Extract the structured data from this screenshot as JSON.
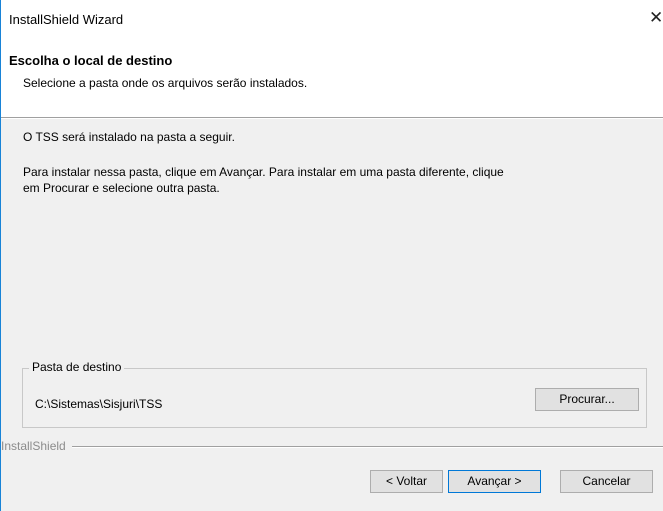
{
  "window": {
    "title": "InstallShield Wizard",
    "close_glyph": "✕"
  },
  "header": {
    "title": "Escolha o local de destino",
    "subtitle": "Selecione a pasta onde os arquivos serão instalados."
  },
  "body": {
    "line1": "O TSS será instalado na pasta a seguir.",
    "line2a": "Para instalar nessa pasta, clique em Avançar. Para instalar em uma pasta diferente, clique",
    "line2b": "em Procurar e selecione outra pasta."
  },
  "destination": {
    "legend": "Pasta de destino",
    "path": "C:\\Sistemas\\Sisjuri\\TSS",
    "browse_label": "Procurar..."
  },
  "footer": {
    "brand": "InstallShield",
    "back_label": "< Voltar",
    "next_label": "Avançar >",
    "cancel_label": "Cancelar"
  },
  "colors": {
    "accent_border": "#1883d7",
    "dialog_bg": "#f0f0f0"
  },
  "icons": {
    "close": "close-icon"
  }
}
